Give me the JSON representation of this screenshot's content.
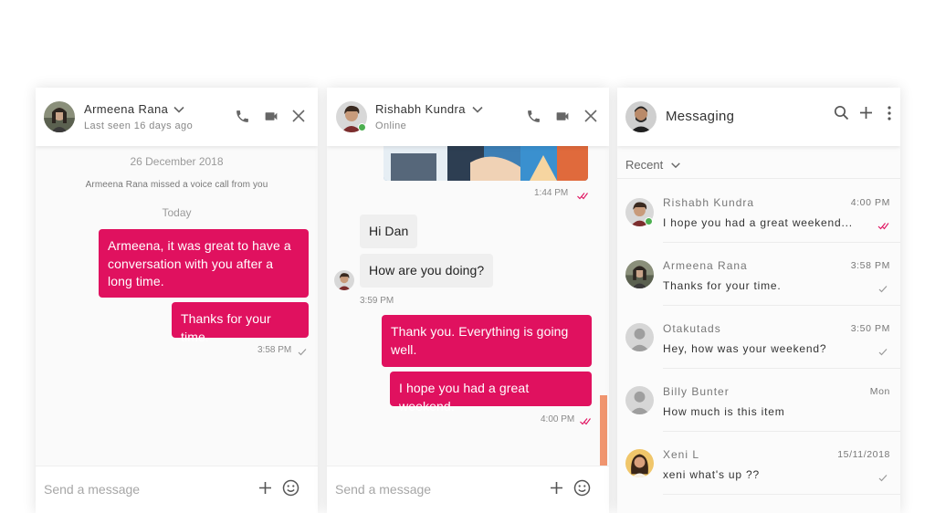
{
  "colors": {
    "accent": "#e0115f",
    "online": "#4caf50",
    "scroll_thumb": "#f0956f"
  },
  "chat1": {
    "contact_name": "Armeena Rana",
    "status": "Last seen 16 days ago",
    "date_divider": "26 December 2018",
    "system_note": "Armeena Rana missed a voice call from you",
    "today_divider": "Today",
    "messages": [
      {
        "text": "Armeena, it was great to have a conversation with you after a long time.",
        "direction": "out"
      },
      {
        "text": "Thanks for your time.",
        "direction": "out",
        "time": "3:58 PM"
      }
    ],
    "composer_placeholder": "Send a message",
    "icons": [
      "chevron-down-icon",
      "phone-icon",
      "video-icon",
      "close-icon",
      "plus-icon",
      "emoji-icon"
    ]
  },
  "chat2": {
    "contact_name": "Rishabh Kundra",
    "status": "Online",
    "image_time": "1:44 PM",
    "messages": [
      {
        "text": "Hi Dan",
        "direction": "in"
      },
      {
        "text": "How are you doing?",
        "direction": "in",
        "time": "3:59 PM"
      },
      {
        "text": "Thank you. Everything is going well.",
        "direction": "out"
      },
      {
        "text": "I hope you had a great weekend.",
        "direction": "out",
        "time": "4:00 PM"
      }
    ],
    "composer_placeholder": "Send a message"
  },
  "messaging": {
    "title": "Messaging",
    "filter": "Recent",
    "conversations": [
      {
        "name": "Rishabh Kundra",
        "time": "4:00 PM",
        "preview": "I hope you had a great weekend...",
        "tick": "double"
      },
      {
        "name": "Armeena Rana",
        "time": "3:58 PM",
        "preview": "Thanks for your time.",
        "tick": "single"
      },
      {
        "name": "Otakutads",
        "time": "3:50 PM",
        "preview": "Hey, how was your weekend?",
        "tick": "single"
      },
      {
        "name": "Billy Bunter",
        "time": "Mon",
        "preview": "How much is this item",
        "tick": "none"
      },
      {
        "name": "Xeni L",
        "time": "15/11/2018",
        "preview": "xeni what's up ??",
        "tick": "single"
      }
    ],
    "icons": [
      "search-icon",
      "plus-icon",
      "more-vertical-icon",
      "chevron-down-icon"
    ]
  }
}
